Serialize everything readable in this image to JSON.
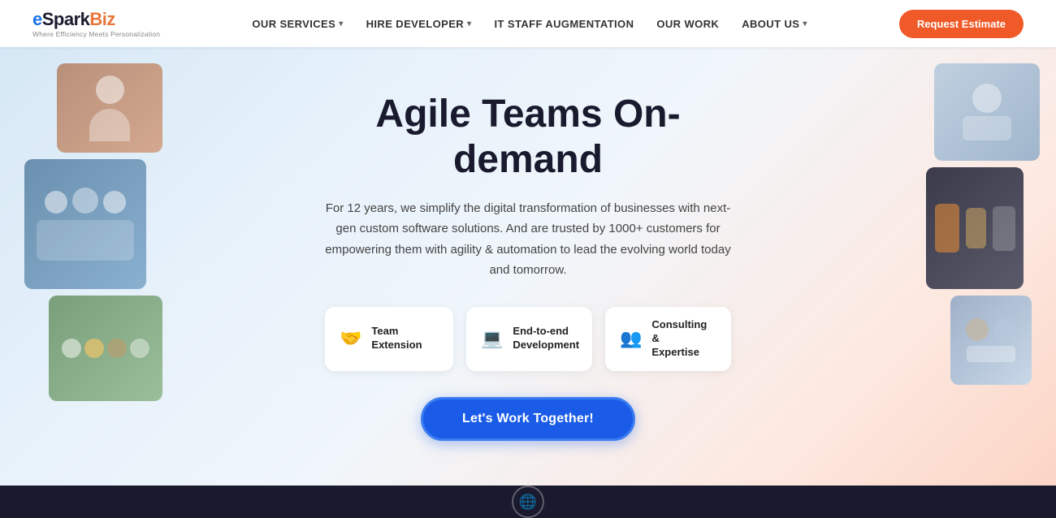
{
  "nav": {
    "logo": {
      "brand": "eSparkBiz",
      "tagline": "Where Efficiency Meets Personalization"
    },
    "links": [
      {
        "label": "OUR SERVICES",
        "hasDropdown": true
      },
      {
        "label": "HIRE DEVELOPER",
        "hasDropdown": true
      },
      {
        "label": "IT STAFF AUGMENTATION",
        "hasDropdown": false
      },
      {
        "label": "OUR WORK",
        "hasDropdown": false
      },
      {
        "label": "ABOUT US",
        "hasDropdown": true
      }
    ],
    "cta_button": "Request Estimate"
  },
  "hero": {
    "title": "Agile Teams On-demand",
    "description": "For 12 years, we simplify the digital transformation of businesses with next-gen custom software solutions. And are trusted by 1000+ customers for empowering them with agility & automation to lead the evolving world today and tomorrow.",
    "features": [
      {
        "icon": "🤝",
        "label": "Team Extension"
      },
      {
        "icon": "💻",
        "label": "End-to-end\nDevelopment"
      },
      {
        "icon": "👥",
        "label": "Consulting &\nExpertise"
      }
    ],
    "cta_button": "Let's Work Together!"
  }
}
